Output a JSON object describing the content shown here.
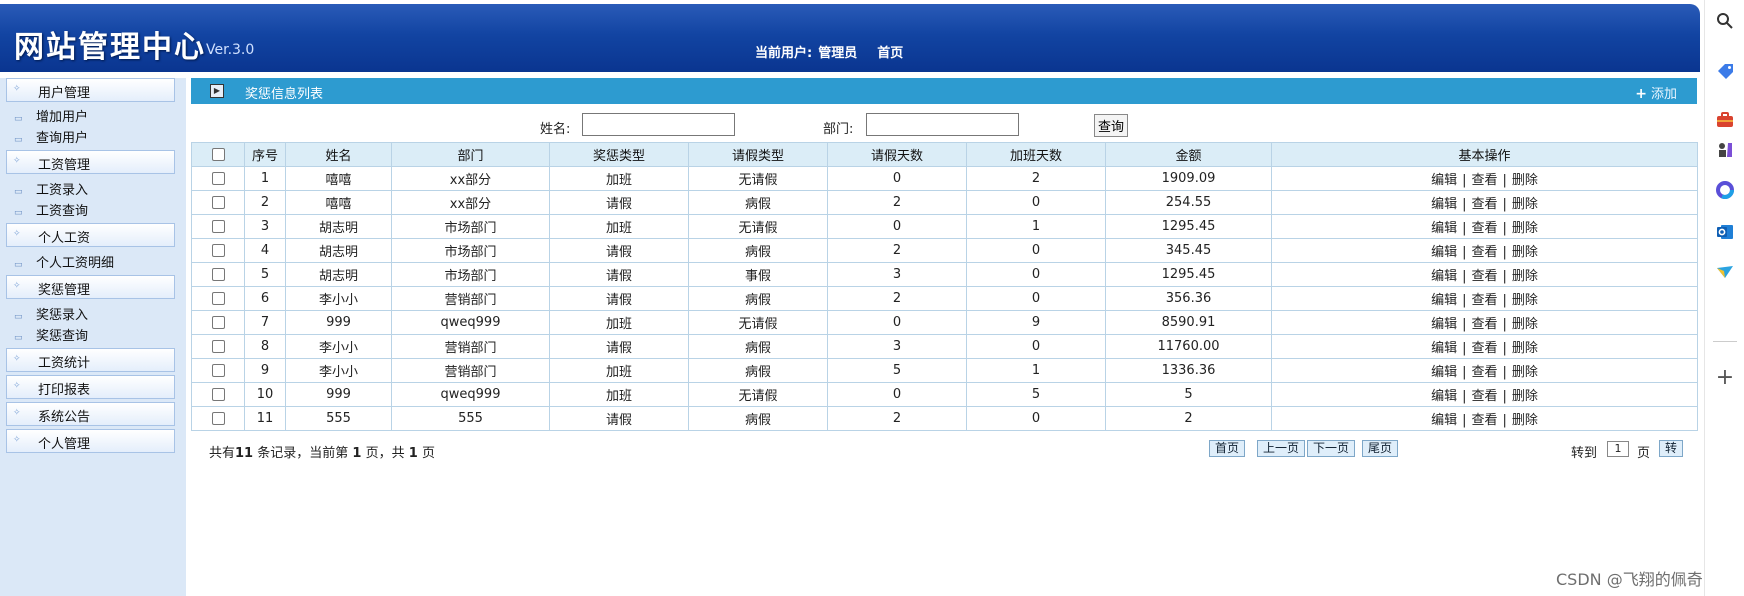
{
  "header": {
    "logo": "网站管理中心",
    "version": "Ver.3.0",
    "current_user_label": "当前用户:",
    "current_user": "管理员",
    "home_link": "首页"
  },
  "sidebar": {
    "groups": [
      {
        "label": "用户管理",
        "items": [
          "增加用户",
          "查询用户"
        ]
      },
      {
        "label": "工资管理",
        "items": [
          "工资录入",
          "工资查询"
        ]
      },
      {
        "label": "个人工资",
        "items": [
          "个人工资明细"
        ]
      },
      {
        "label": "奖惩管理",
        "items": [
          "奖惩录入",
          "奖惩查询"
        ]
      },
      {
        "label": "工资统计",
        "items": []
      },
      {
        "label": "打印报表",
        "items": []
      },
      {
        "label": "系统公告",
        "items": []
      },
      {
        "label": "个人管理",
        "items": []
      }
    ]
  },
  "title_bar": {
    "title": "奖惩信息列表",
    "add_label": "添加"
  },
  "search": {
    "name_label": "姓名:",
    "name_value": "",
    "dept_label": "部门:",
    "dept_value": "",
    "query_button": "查询"
  },
  "table": {
    "headers": [
      "序号",
      "姓名",
      "部门",
      "奖惩类型",
      "请假类型",
      "请假天数",
      "加班天数",
      "金额",
      "基本操作"
    ],
    "rows": [
      {
        "no": "1",
        "name": "嘻嘻",
        "dept": "xx部分",
        "type": "加班",
        "leave_type": "无请假",
        "leave_days": "0",
        "ot_days": "2",
        "amount": "1909.09"
      },
      {
        "no": "2",
        "name": "嘻嘻",
        "dept": "xx部分",
        "type": "请假",
        "leave_type": "病假",
        "leave_days": "2",
        "ot_days": "0",
        "amount": "254.55"
      },
      {
        "no": "3",
        "name": "胡志明",
        "dept": "市场部门",
        "type": "加班",
        "leave_type": "无请假",
        "leave_days": "0",
        "ot_days": "1",
        "amount": "1295.45"
      },
      {
        "no": "4",
        "name": "胡志明",
        "dept": "市场部门",
        "type": "请假",
        "leave_type": "病假",
        "leave_days": "2",
        "ot_days": "0",
        "amount": "345.45"
      },
      {
        "no": "5",
        "name": "胡志明",
        "dept": "市场部门",
        "type": "请假",
        "leave_type": "事假",
        "leave_days": "3",
        "ot_days": "0",
        "amount": "1295.45"
      },
      {
        "no": "6",
        "name": "李小小",
        "dept": "营销部门",
        "type": "请假",
        "leave_type": "病假",
        "leave_days": "2",
        "ot_days": "0",
        "amount": "356.36"
      },
      {
        "no": "7",
        "name": "999",
        "dept": "qweq999",
        "type": "加班",
        "leave_type": "无请假",
        "leave_days": "0",
        "ot_days": "9",
        "amount": "8590.91"
      },
      {
        "no": "8",
        "name": "李小小",
        "dept": "营销部门",
        "type": "请假",
        "leave_type": "病假",
        "leave_days": "3",
        "ot_days": "0",
        "amount": "11760.00"
      },
      {
        "no": "9",
        "name": "李小小",
        "dept": "营销部门",
        "type": "加班",
        "leave_type": "病假",
        "leave_days": "5",
        "ot_days": "1",
        "amount": "1336.36"
      },
      {
        "no": "10",
        "name": "999",
        "dept": "qweq999",
        "type": "加班",
        "leave_type": "无请假",
        "leave_days": "0",
        "ot_days": "5",
        "amount": "5"
      },
      {
        "no": "11",
        "name": "555",
        "dept": "555",
        "type": "请假",
        "leave_type": "病假",
        "leave_days": "2",
        "ot_days": "0",
        "amount": "2"
      }
    ],
    "ops": {
      "edit": "编辑",
      "view": "查看",
      "delete": "删除",
      "separator": "|"
    }
  },
  "pager": {
    "summary_prefix": "共有",
    "total": "11",
    "summary_mid": "条记录，当前第",
    "current": "1",
    "summary_mid2": "页，共",
    "pages": "1",
    "summary_suffix": "页",
    "first": "首页",
    "prev": "上一页",
    "next": "下一页",
    "last": "尾页",
    "goto_label": "转到",
    "goto_value": "1",
    "page_unit": "页",
    "go": "转"
  },
  "browser_sidebar": {
    "icons": [
      "search-icon",
      "tag-icon",
      "briefcase-icon",
      "chess-icon",
      "copilot-icon",
      "outlook-icon",
      "send-icon",
      "plus-icon"
    ]
  },
  "watermark": "CSDN @飞翔的佩奇",
  "colors": {
    "header_bg": "#1244a2",
    "title_bar_bg": "#2d9bd0",
    "table_header_bg": "#dbedf7",
    "sidebar_bg": "#dbe8f7"
  }
}
